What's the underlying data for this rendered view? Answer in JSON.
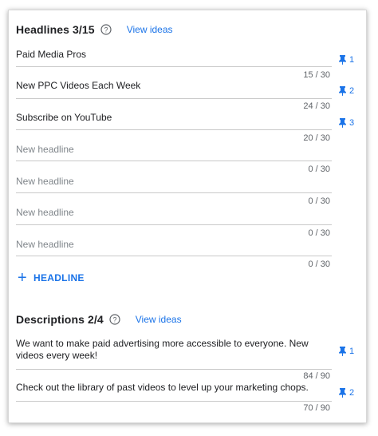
{
  "headlines": {
    "title": "Headlines 3/15",
    "view_ideas": "View ideas",
    "add_label": "HEADLINE",
    "items": [
      {
        "text": "Paid Media Pros",
        "count": "15 / 30",
        "pin": "1",
        "placeholder": false
      },
      {
        "text": "New PPC Videos Each Week",
        "count": "24 / 30",
        "pin": "2",
        "placeholder": false
      },
      {
        "text": "Subscribe on YouTube",
        "count": "20 / 30",
        "pin": "3",
        "placeholder": false
      },
      {
        "text": "New headline",
        "count": "0 / 30",
        "placeholder": true
      },
      {
        "text": "New headline",
        "count": "0 / 30",
        "placeholder": true
      },
      {
        "text": "New headline",
        "count": "0 / 30",
        "placeholder": true
      },
      {
        "text": "New headline",
        "count": "0 / 30",
        "placeholder": true
      }
    ]
  },
  "descriptions": {
    "title": "Descriptions 2/4",
    "view_ideas": "View ideas",
    "items": [
      {
        "text": "We want to make paid advertising more accessible to everyone. New videos every week!",
        "count": "84 / 90",
        "pin": "1"
      },
      {
        "text": "Check out the library of past videos to level up your marketing chops.",
        "count": "70 / 90",
        "pin": "2"
      }
    ]
  },
  "colors": {
    "accent": "#1a73e8",
    "divider": "#c9c9c9",
    "placeholder": "#80868b"
  }
}
